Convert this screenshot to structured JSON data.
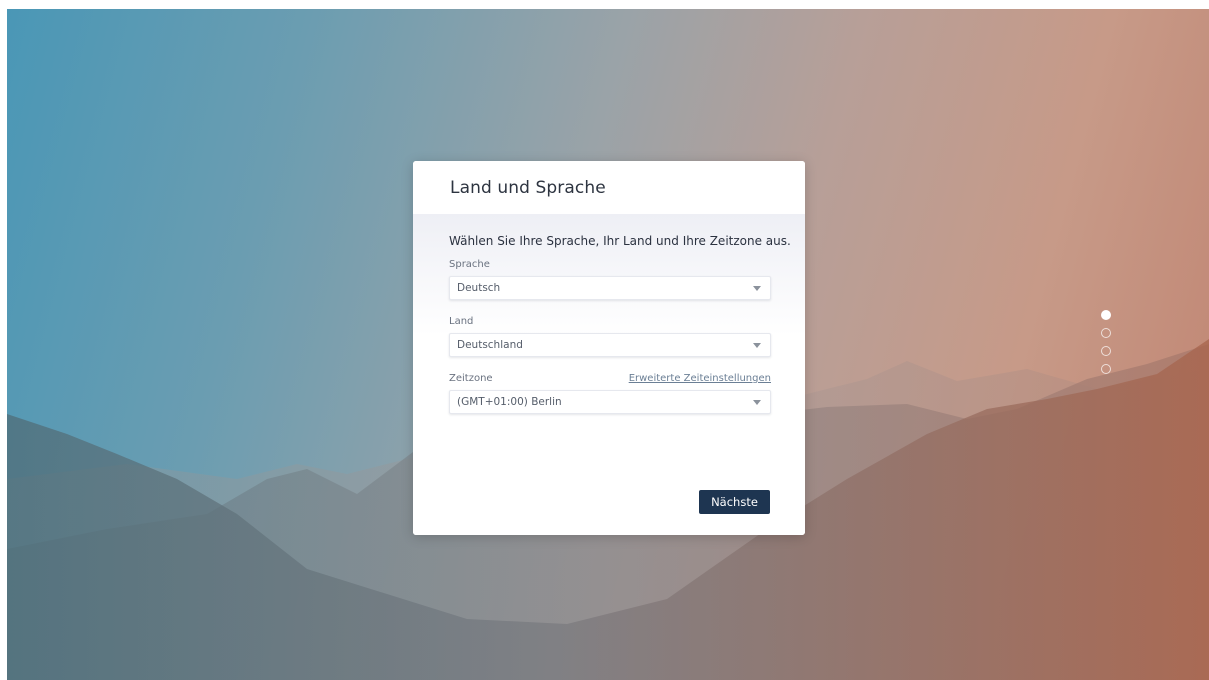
{
  "dialog": {
    "title": "Land und Sprache",
    "intro": "Wählen Sie Ihre Sprache, Ihr Land und Ihre Zeitzone aus.",
    "fields": {
      "language": {
        "label": "Sprache",
        "value": "Deutsch"
      },
      "country": {
        "label": "Land",
        "value": "Deutschland"
      },
      "timezone": {
        "label": "Zeitzone",
        "value": "(GMT+01:00) Berlin",
        "link": "Erweiterte Zeiteinstellungen"
      }
    },
    "next_label": "Nächste"
  },
  "steps": {
    "total": 4,
    "current": 1
  },
  "colors": {
    "accent_button": "#1e3551",
    "background_left": "#4a97b6",
    "background_right": "#c08370"
  }
}
